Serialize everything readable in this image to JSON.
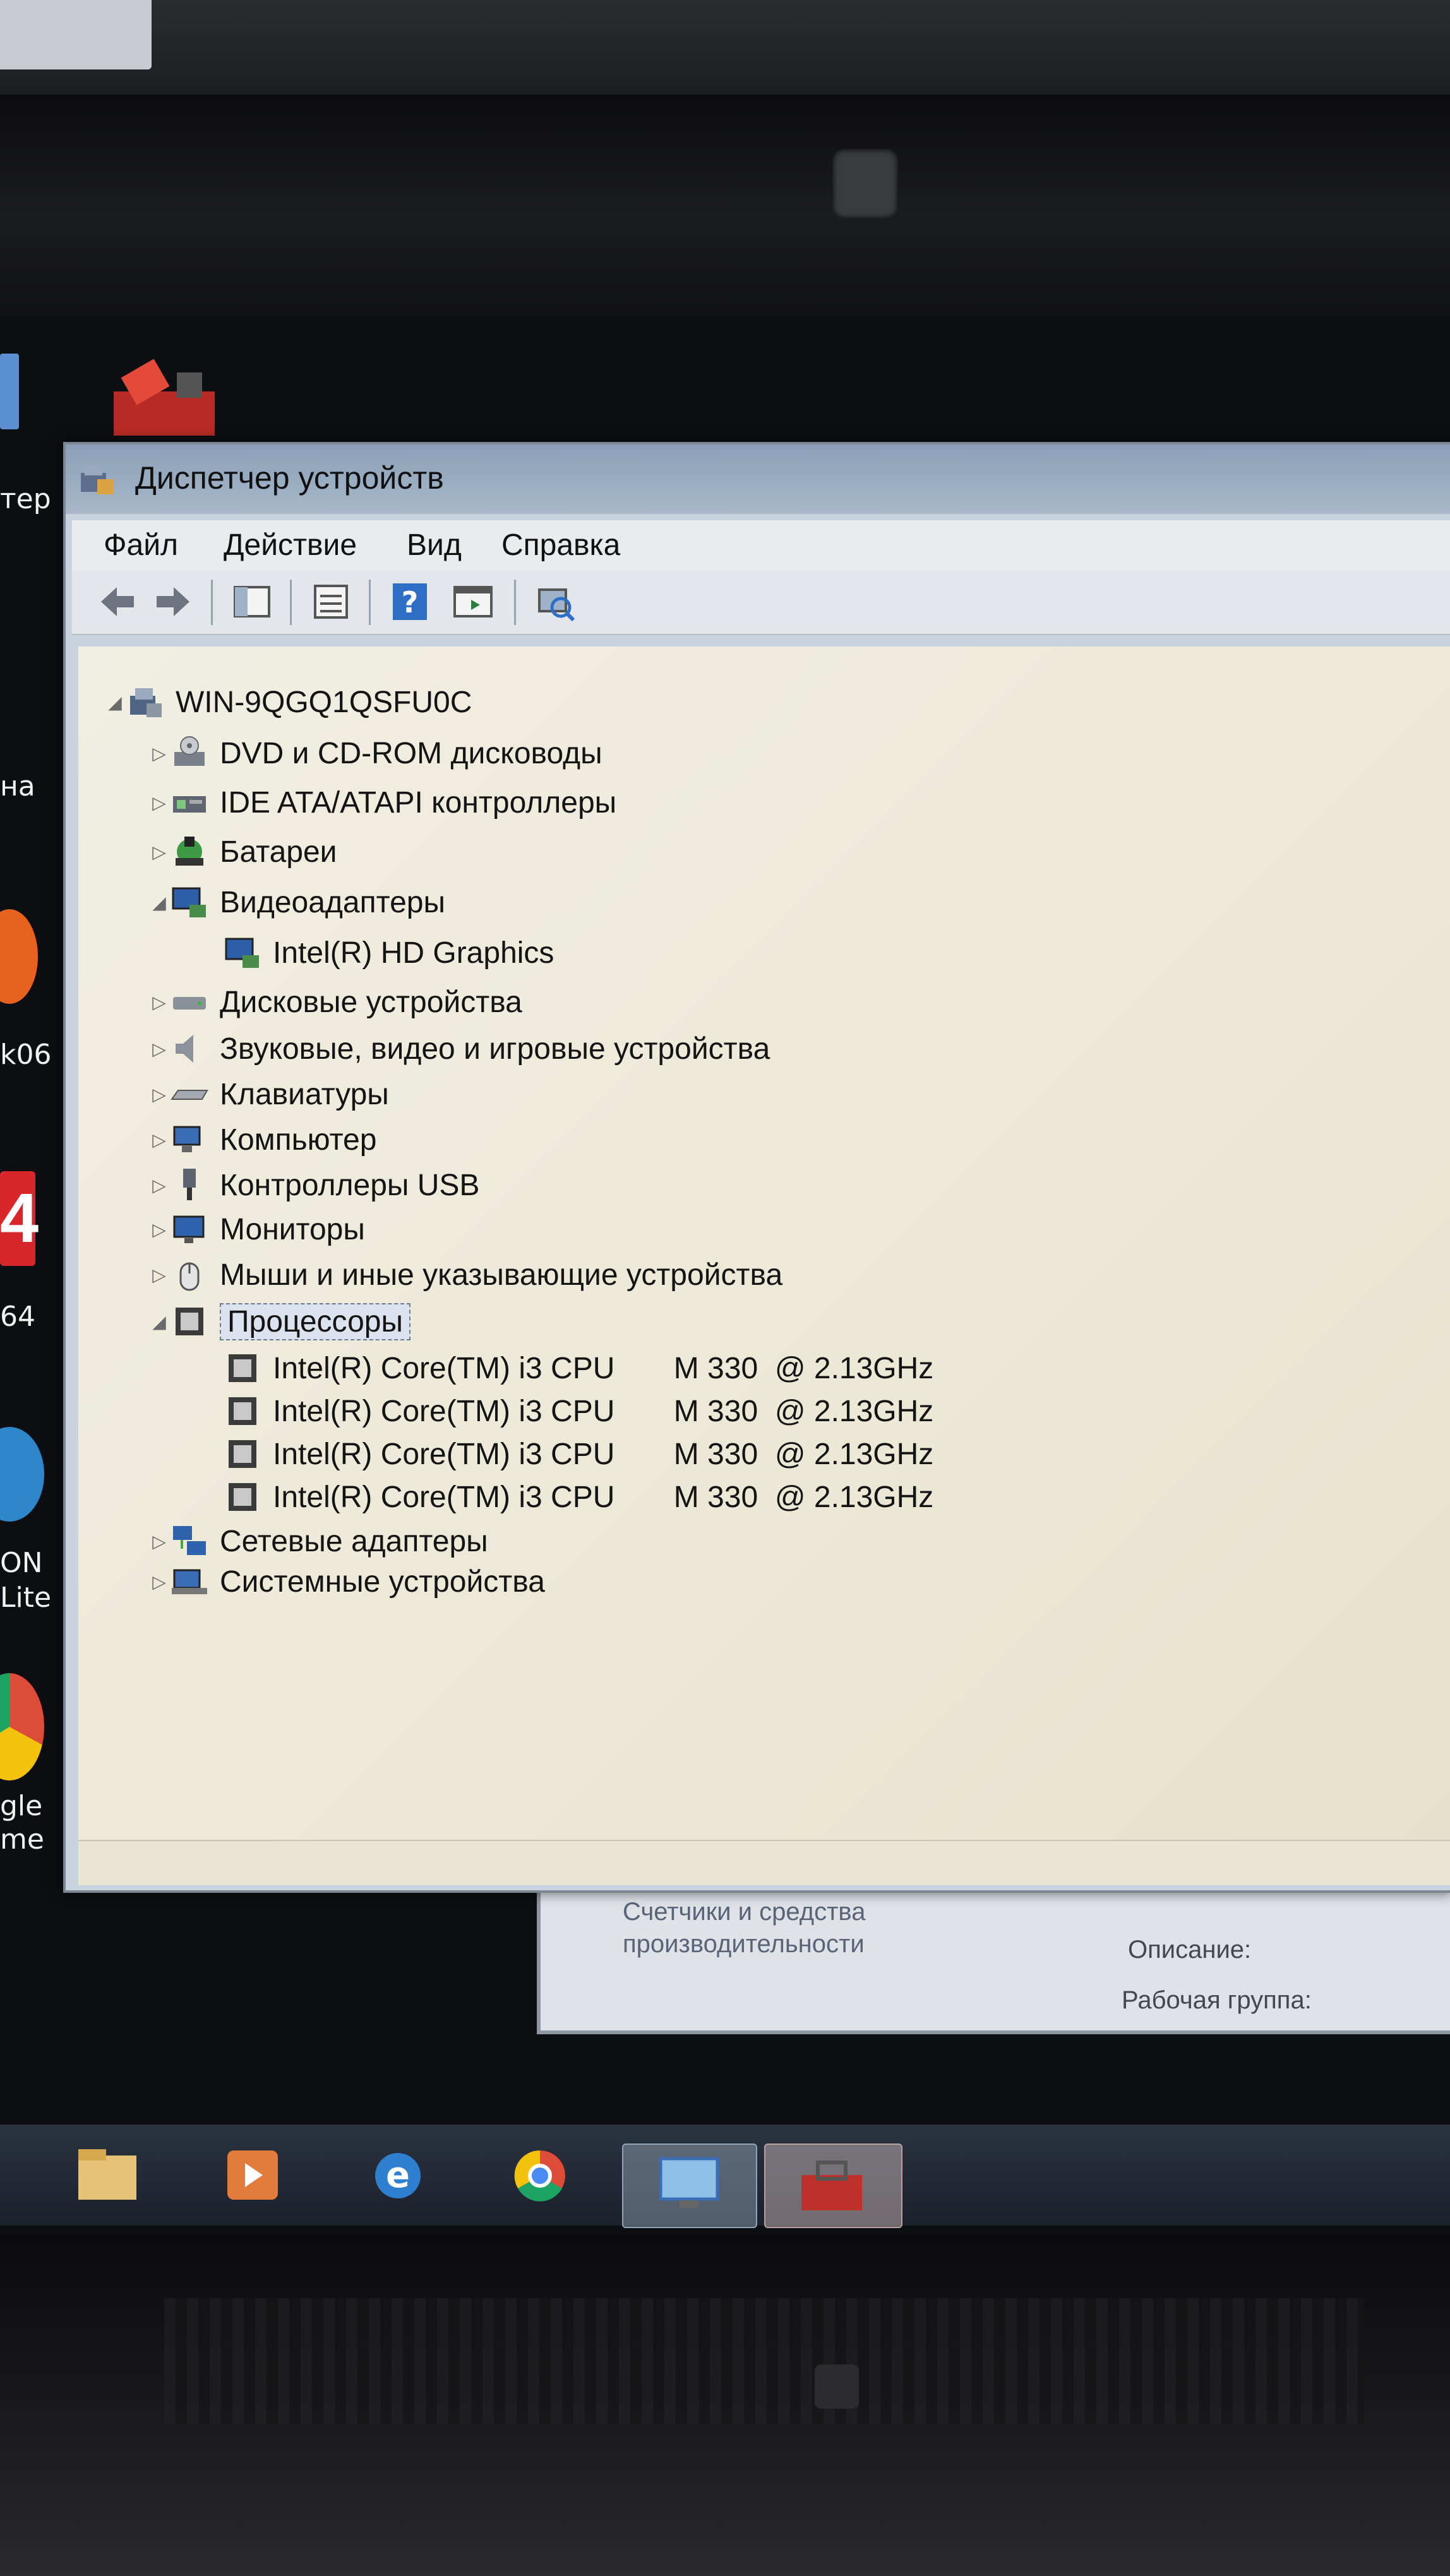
{
  "desktop": {
    "labels": [
      "тер",
      "на",
      "k06",
      "64",
      "ON",
      "Lite",
      "gle",
      "me"
    ],
    "badge_digit": "4"
  },
  "window": {
    "title": "Диспетчер устройств",
    "menu": [
      "Файл",
      "Действие",
      "Вид",
      "Справка"
    ],
    "toolbar_icons": [
      "back-arrow-icon",
      "forward-arrow-icon",
      "show-hide-tree-icon",
      "properties-icon",
      "help-icon",
      "action-pane-icon",
      "scan-hardware-icon"
    ]
  },
  "tree": {
    "root": "WIN-9QGQ1QSFU0C",
    "items": [
      {
        "label": "DVD и CD-ROM дисководы",
        "expanded": false,
        "icon": "dvd-drive-icon"
      },
      {
        "label": "IDE ATA/ATAPI контроллеры",
        "expanded": false,
        "icon": "ide-controller-icon"
      },
      {
        "label": "Батареи",
        "expanded": false,
        "icon": "battery-icon"
      },
      {
        "label": "Видеоадаптеры",
        "expanded": true,
        "icon": "display-adapter-icon",
        "children": [
          "Intel(R) HD Graphics"
        ]
      },
      {
        "label": "Дисковые устройства",
        "expanded": false,
        "icon": "disk-drive-icon"
      },
      {
        "label": "Звуковые, видео и игровые устройства",
        "expanded": false,
        "icon": "sound-icon"
      },
      {
        "label": "Клавиатуры",
        "expanded": false,
        "icon": "keyboard-icon"
      },
      {
        "label": "Компьютер",
        "expanded": false,
        "icon": "computer-icon"
      },
      {
        "label": "Контроллеры USB",
        "expanded": false,
        "icon": "usb-icon"
      },
      {
        "label": "Мониторы",
        "expanded": false,
        "icon": "monitor-icon"
      },
      {
        "label": "Мыши и иные указывающие устройства",
        "expanded": false,
        "icon": "mouse-icon"
      },
      {
        "label": "Процессоры",
        "expanded": true,
        "selected": true,
        "icon": "processor-icon",
        "children": [
          "Intel(R) Core(TM) i3 CPU       M 330  @ 2.13GHz",
          "Intel(R) Core(TM) i3 CPU       M 330  @ 2.13GHz",
          "Intel(R) Core(TM) i3 CPU       M 330  @ 2.13GHz",
          "Intel(R) Core(TM) i3 CPU       M 330  @ 2.13GHz"
        ]
      },
      {
        "label": "Сетевые адаптеры",
        "expanded": false,
        "icon": "network-adapter-icon"
      },
      {
        "label": "Системные устройства",
        "expanded": false,
        "icon": "system-devices-icon"
      }
    ]
  },
  "background_window": {
    "link": "Счетчики и средства производительности",
    "link_line1": "Счетчики и средства",
    "link_line2": "производительности",
    "description_label": "Описание:",
    "workgroup_label": "Рабочая группа:"
  },
  "taskbar": {
    "items": [
      "explorer-icon",
      "media-player-icon",
      "internet-explorer-icon",
      "chrome-icon",
      "system-properties-icon",
      "device-manager-icon"
    ]
  },
  "colors": {
    "tree_bg": "#efecdf",
    "titlebar": "#a7b7c8",
    "selection_border": "#6c7a8f"
  }
}
